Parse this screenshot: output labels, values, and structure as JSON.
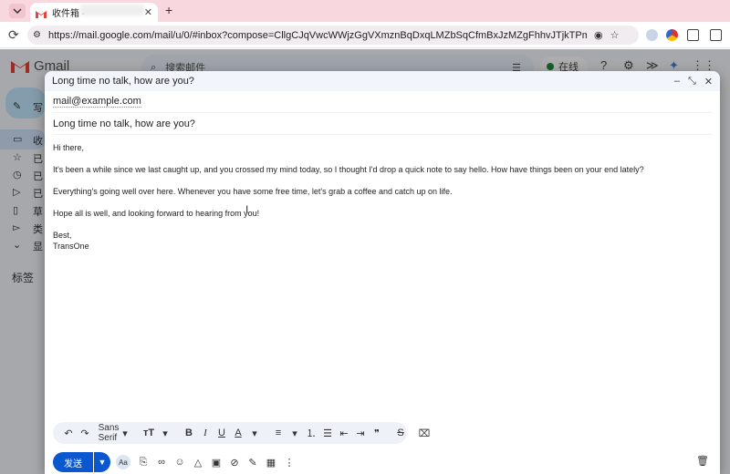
{
  "browser": {
    "tab_title": "收件箱 -",
    "tab_close": "✕",
    "new_tab": "+",
    "url": "https://mail.google.com/mail/u/0/#inbox?compose=CllgCJqVwcWWjzGgVXmznBqDxqLMZbSqCfmBxJzMZgFhhvJTjkTPmtdljfTsSQcDmgMVqhcgxxq"
  },
  "gmail": {
    "wordmark": "Gmail",
    "search_placeholder": "搜索邮件",
    "status_label": "在线",
    "sidebar_peek": [
      "收",
      "已",
      "已",
      "已",
      "草",
      "类",
      "显"
    ],
    "compose_peek": "写",
    "labels_heading": "标签"
  },
  "compose": {
    "title": "Long time no talk, how are you?",
    "to": "mail@example.com",
    "subject": "Long time no talk, how are you?",
    "body": {
      "greeting": "Hi there,",
      "p1": "It's been a while since we last caught up, and you crossed my mind today, so I thought I'd drop a quick note to say hello. How have things been on your end lately?",
      "p2": "Everything's going well over here. Whenever you have some free time, let's grab a coffee and catch up on life.",
      "p3": "Hope all is well, and looking forward to hearing from you!",
      "closing": "Best,",
      "signature": "TransOne"
    },
    "format_font": "Sans Serif",
    "send_label": "发送",
    "aa_label": "Aa"
  },
  "colors": {
    "send_blue": "#0b57d0",
    "tab_strip": "#f8d7de",
    "header_bg": "#f2f6fc"
  }
}
